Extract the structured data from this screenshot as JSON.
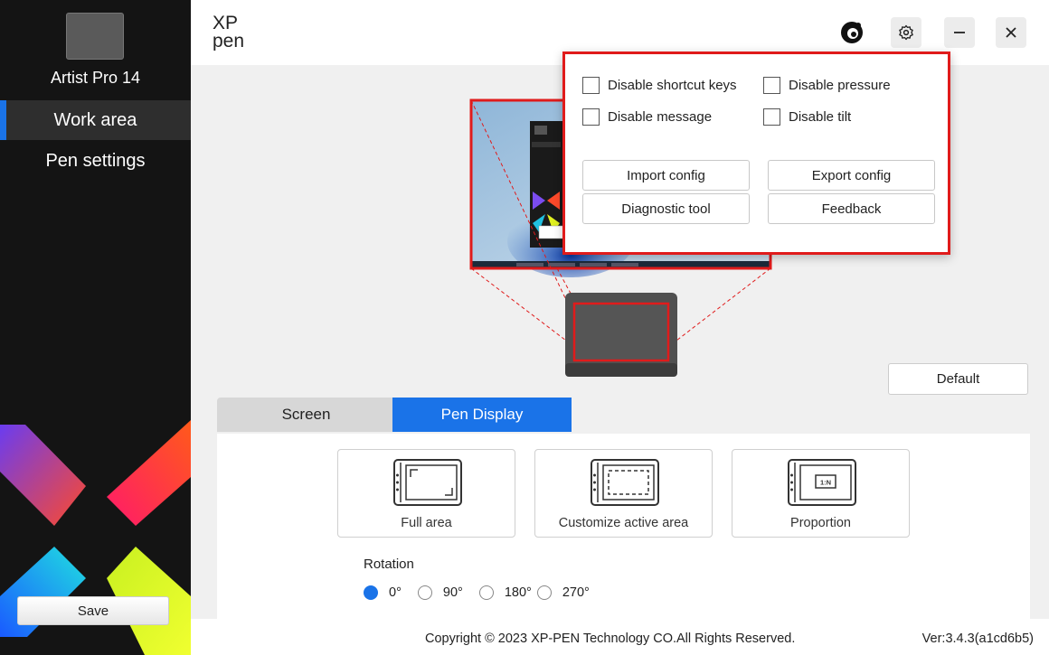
{
  "sidebar": {
    "device_name": "Artist Pro 14",
    "items": [
      {
        "label": "Work area",
        "active": true
      },
      {
        "label": "Pen settings",
        "active": false
      }
    ],
    "save_label": "Save"
  },
  "header": {
    "logo_text_top": "XP",
    "logo_text_bottom": "pen",
    "icons": [
      "xppen-round-logo-icon",
      "gear-icon",
      "minimize-icon",
      "close-icon"
    ]
  },
  "settings_popup": {
    "checkboxes": [
      {
        "label": "Disable shortcut keys",
        "checked": false
      },
      {
        "label": "Disable pressure",
        "checked": false
      },
      {
        "label": "Disable message",
        "checked": false
      },
      {
        "label": "Disable tilt",
        "checked": false
      }
    ],
    "buttons": {
      "import": "Import config",
      "export": "Export config",
      "diagnostic": "Diagnostic tool",
      "feedback": "Feedback"
    }
  },
  "work_area": {
    "default_label": "Default",
    "tabs": [
      {
        "label": "Screen",
        "active": false
      },
      {
        "label": "Pen Display",
        "active": true
      }
    ],
    "modes": [
      {
        "label": "Full area",
        "icon": "full-area-icon"
      },
      {
        "label": "Customize active area",
        "icon": "customize-area-icon"
      },
      {
        "label": "Proportion",
        "icon": "proportion-icon",
        "icon_text": "1:N"
      }
    ],
    "rotation": {
      "title": "Rotation",
      "options": [
        "0°",
        "90°",
        "180°",
        "270°"
      ],
      "selected": "0°"
    }
  },
  "footer": {
    "copyright": "Copyright © 2023  XP-PEN Technology CO.All Rights Reserved.",
    "version": "Ver:3.4.3(a1cd6b5)"
  },
  "colors": {
    "accent": "#1a73e8",
    "highlight_red": "#e01b1b",
    "sidebar_bg": "#141414"
  }
}
